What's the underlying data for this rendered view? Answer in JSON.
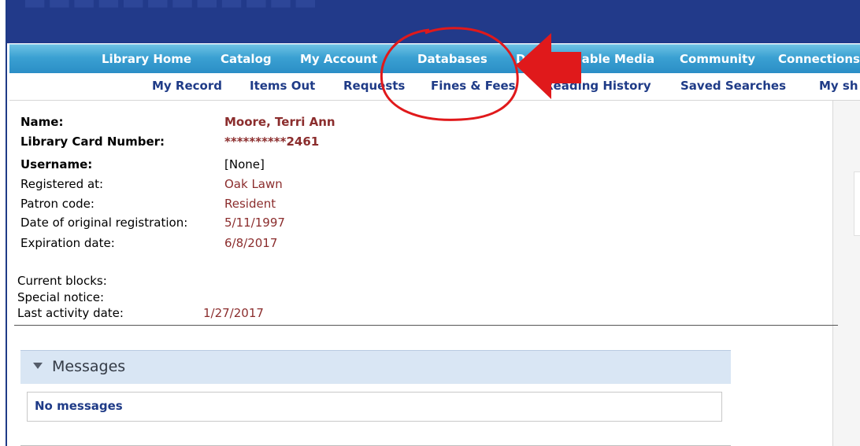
{
  "main_nav": {
    "items": [
      "Library Home",
      "Catalog",
      "My Account",
      "Databases",
      "Downloadable Media",
      "Community",
      "Connections"
    ]
  },
  "sub_nav": {
    "items": [
      "My Record",
      "Items Out",
      "Requests",
      "Fines & Fees",
      "Reading History",
      "Saved Searches",
      "My sh"
    ]
  },
  "record": {
    "name_label": "Name:",
    "name_value": "Moore, Terri Ann",
    "card_label": "Library Card Number:",
    "card_value": "**********2461",
    "username_label": "Username:",
    "username_value": "[None]",
    "registered_label": "Registered at:",
    "registered_value": "Oak Lawn",
    "patron_label": "Patron code:",
    "patron_value": "Resident",
    "orig_reg_label": "Date of original registration:",
    "orig_reg_value": "5/11/1997",
    "expiration_label": "Expiration date:",
    "expiration_value": "6/8/2017",
    "blocks_label": "Current blocks:",
    "notice_label": "Special notice:",
    "last_activity_label": "Last activity date:",
    "last_activity_value": "1/27/2017"
  },
  "messages": {
    "title": "Messages",
    "empty_text": "No messages"
  },
  "colors": {
    "banner": "#223a8a",
    "nav_blue": "#2b8ec6",
    "link_navy": "#1f3b87",
    "value_red": "#8b2d2d",
    "annotation_red": "#e0191b"
  },
  "icons": {
    "collapse": "triangle-down-icon",
    "annotation_arrow": "red-arrow-icon",
    "annotation_circle": "red-circle-mark"
  }
}
